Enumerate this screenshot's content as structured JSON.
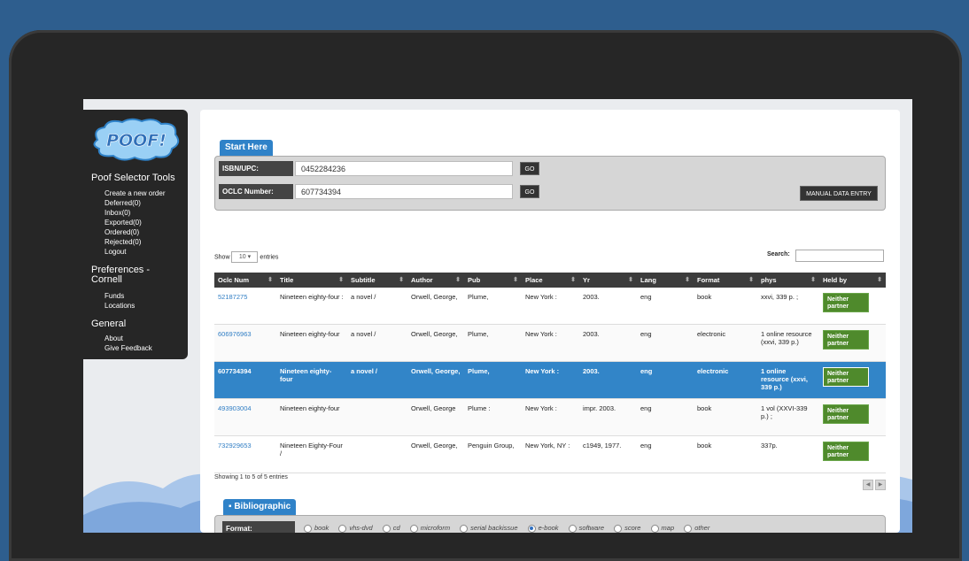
{
  "sidebar": {
    "logo_text": "POOF!",
    "sections": [
      {
        "title": "Poof Selector Tools",
        "links": [
          "Create a new order",
          "Deferred(0)",
          "Inbox(0)",
          "Exported(0)",
          "Ordered(0)",
          "Rejected(0)",
          "Logout"
        ]
      },
      {
        "title": "Preferences - Cornell",
        "links": [
          "Funds",
          "Locations"
        ]
      },
      {
        "title": "General",
        "links": [
          "About",
          "Give Feedback"
        ]
      }
    ]
  },
  "start_here": {
    "tab_label": "Start Here",
    "isbn_label": "ISBN/UPC:",
    "isbn_value": "0452284236",
    "oclc_label": "OCLC Number:",
    "oclc_value": "607734394",
    "go_label": "GO",
    "manual_entry_label": "MANUAL DATA ENTRY"
  },
  "table_controls": {
    "show_label": "Show",
    "show_value": "10",
    "entries_label": "entries",
    "search_label": "Search:"
  },
  "table": {
    "columns": [
      "Oclc Num",
      "Title",
      "Subtitle",
      "Author",
      "Pub",
      "Place",
      "Yr",
      "Lang",
      "Format",
      "phys",
      "Held by"
    ],
    "rows": [
      {
        "oclc": "52187275",
        "title": "Nineteen eighty-four :",
        "subtitle": "a novel /",
        "author": "Orwell, George,",
        "pub": "Plume,",
        "place": "New York :",
        "yr": "2003.",
        "lang": "eng",
        "format": "book",
        "phys": "xxvi, 339 p. ;",
        "held": "Neither partner",
        "selected": false
      },
      {
        "oclc": "606976963",
        "title": "Nineteen eighty-four",
        "subtitle": "a novel /",
        "author": "Orwell, George,",
        "pub": "Plume,",
        "place": "New York :",
        "yr": "2003.",
        "lang": "eng",
        "format": "electronic",
        "phys": "1 online resource (xxvi, 339 p.)",
        "held": "Neither partner",
        "selected": false
      },
      {
        "oclc": "607734394",
        "title": "Nineteen eighty-four",
        "subtitle": "a novel /",
        "author": "Orwell, George,",
        "pub": "Plume,",
        "place": "New York :",
        "yr": "2003.",
        "lang": "eng",
        "format": "electronic",
        "phys": "1 online resource (xxvi, 339 p.)",
        "held": "Neither partner",
        "selected": true
      },
      {
        "oclc": "493903004",
        "title": "Nineteen eighty-four",
        "subtitle": "",
        "author": "Orwell, George",
        "pub": "Plume :",
        "place": "New York :",
        "yr": "impr. 2003.",
        "lang": "eng",
        "format": "book",
        "phys": "1 vol (XXVI-339 p.) ;",
        "held": "Neither partner",
        "selected": false
      },
      {
        "oclc": "732929653",
        "title": "Nineteen Eighty-Four /",
        "subtitle": "",
        "author": "Orwell, George,",
        "pub": "Penguin Group,",
        "place": "New York, NY :",
        "yr": "c1949, 1977.",
        "lang": "eng",
        "format": "book",
        "phys": "337p.",
        "held": "Neither partner",
        "selected": false
      }
    ],
    "showing_text": "Showing 1 to 5 of 5 entries"
  },
  "bibliographic": {
    "tab_label": "Bibliographic",
    "format_label": "Format:",
    "format_options": [
      "book",
      "vhs-dvd",
      "cd",
      "microform",
      "serial backissue",
      "e-book",
      "software",
      "score",
      "map",
      "other"
    ],
    "format_selected": "e-book"
  },
  "colors": {
    "accent": "#2f82c8",
    "held_green": "#4f8a2c",
    "laptop": "#262626",
    "backdrop": "#2e5e8e"
  }
}
